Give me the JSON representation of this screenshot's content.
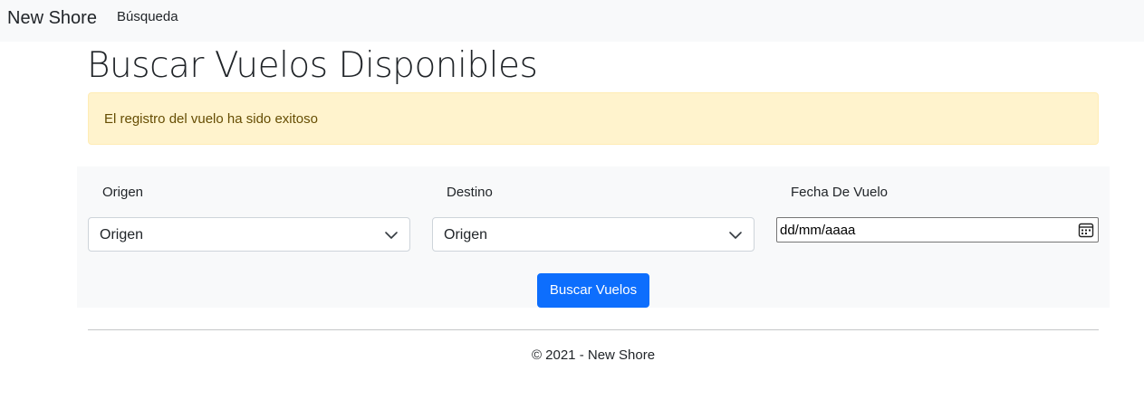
{
  "navbar": {
    "brand": "New Shore",
    "links": [
      {
        "label": "Búsqueda"
      }
    ]
  },
  "page": {
    "title": "Buscar Vuelos Disponibles"
  },
  "alert": {
    "message": "El registro del vuelo ha sido exitoso",
    "color": "#fff3cd"
  },
  "search_form": {
    "origin": {
      "label": "Origen",
      "selected": "Origen"
    },
    "destination": {
      "label": "Destino",
      "selected": "Origen"
    },
    "date": {
      "label": "Fecha De Vuelo",
      "placeholder": "dd/mm/aaaa",
      "icon": "calendar-icon"
    },
    "submit_label": "Buscar Vuelos",
    "accent_color": "#0d6efd"
  },
  "footer": {
    "text": "© 2021 - New Shore"
  }
}
